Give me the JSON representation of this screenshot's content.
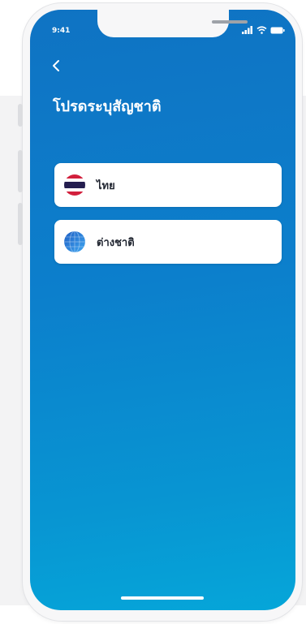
{
  "status_bar": {
    "time": "9:41"
  },
  "header": {
    "back_icon": "chevron-left-icon"
  },
  "page": {
    "title": "โปรดระบุสัญชาติ"
  },
  "options": [
    {
      "label": "ไทย",
      "icon": "thai-flag-icon"
    },
    {
      "label": "ต่างชาติ",
      "icon": "globe-icon"
    }
  ],
  "colors": {
    "screen_gradient_top": "#0f73c3",
    "screen_gradient_bottom": "#05a6d9",
    "card": "#ffffff",
    "card_text": "#202530"
  }
}
